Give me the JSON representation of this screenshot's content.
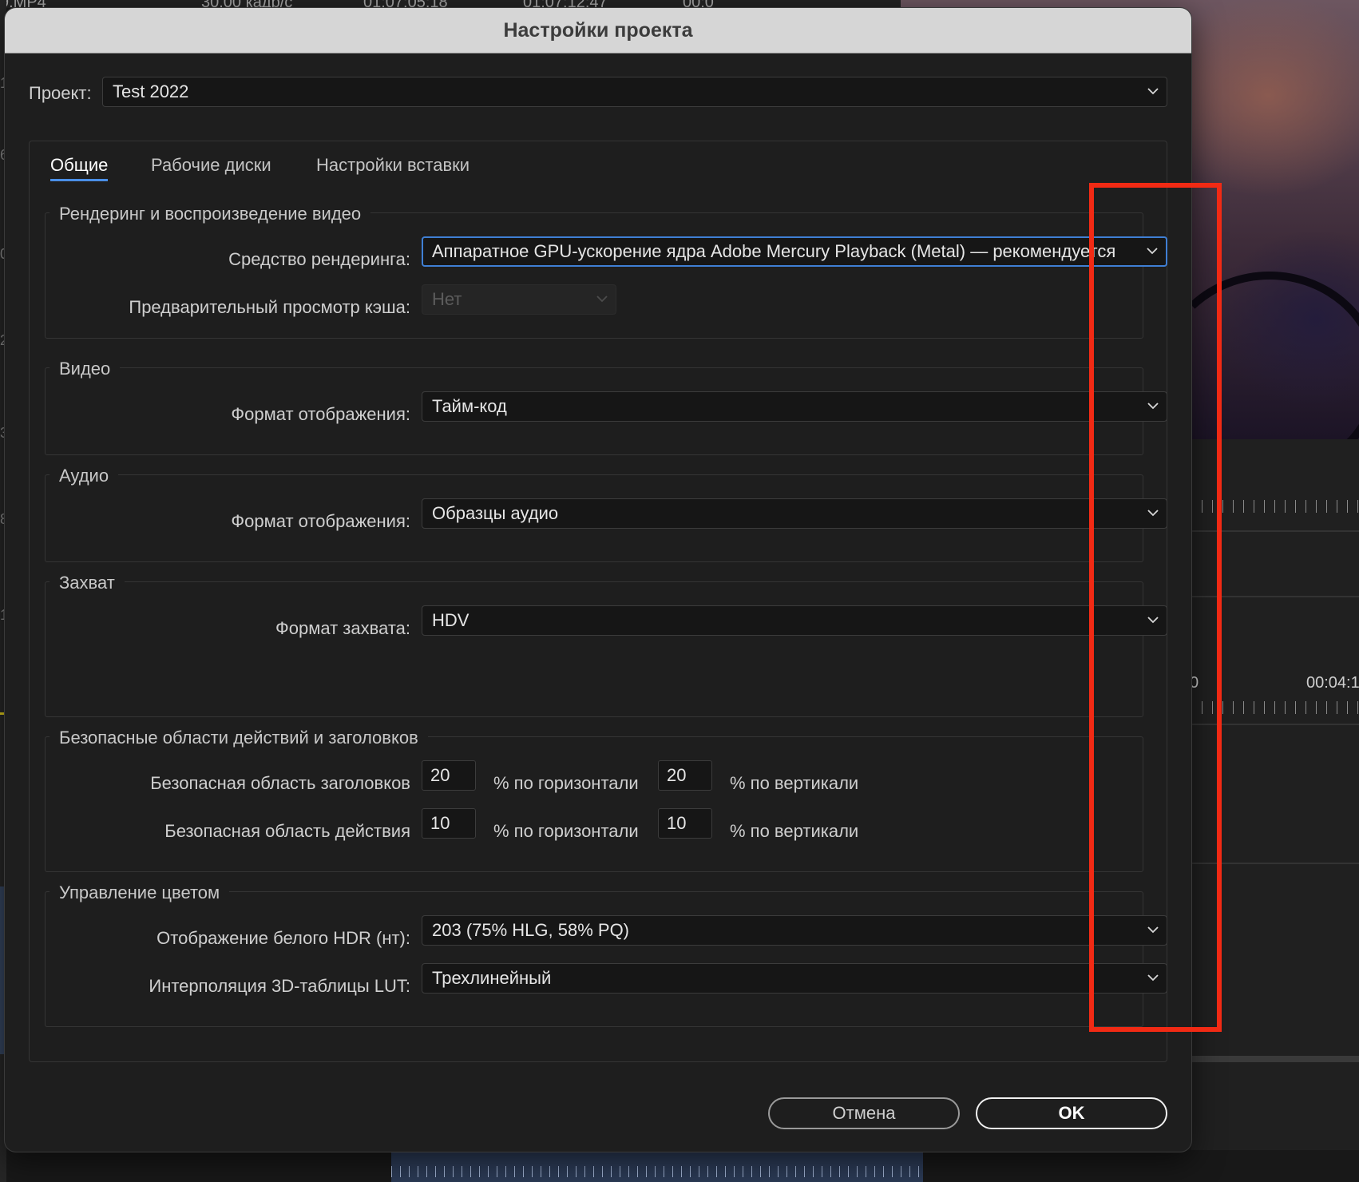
{
  "background": {
    "top_texts": [
      "9.MP4",
      "30,00 кадр/с",
      "01:07:05:18",
      "01:07:12:47",
      "00:0"
    ],
    "left_digits": [
      "1",
      "6",
      "0",
      "2",
      "3",
      "8",
      "1"
    ],
    "timecodes": [
      "0",
      "00:04:1"
    ]
  },
  "dialog": {
    "title": "Настройки проекта",
    "project_label": "Проект:",
    "project_value": "Test 2022",
    "tabs": [
      {
        "label": "Общие",
        "active": true
      },
      {
        "label": "Рабочие диски",
        "active": false
      },
      {
        "label": "Настройки вставки",
        "active": false
      }
    ],
    "render": {
      "title": "Рендеринг и воспроизведение видео",
      "renderer_label": "Средство рендеринга:",
      "renderer_value": "Аппаратное GPU-ускорение ядра Adobe Mercury Playback (Metal)  — рекомендуется",
      "cache_label": "Предварительный просмотр кэша:",
      "cache_value": "Нет"
    },
    "video": {
      "title": "Видео",
      "format_label": "Формат отображения:",
      "format_value": "Тайм-код"
    },
    "audio": {
      "title": "Аудио",
      "format_label": "Формат отображения:",
      "format_value": "Образцы аудио"
    },
    "capture": {
      "title": "Захват",
      "format_label": "Формат захвата:",
      "format_value": "HDV"
    },
    "safe_areas": {
      "title": "Безопасные области действий и заголовков",
      "title_safe_label": "Безопасная область заголовков",
      "title_safe_h": "20",
      "title_safe_v": "20",
      "action_safe_label": "Безопасная область действия",
      "action_safe_h": "10",
      "action_safe_v": "10",
      "h_unit": "% по горизонтали",
      "v_unit": "% по вертикали"
    },
    "color": {
      "title": "Управление цветом",
      "hdr_label": "Отображение белого HDR (нт):",
      "hdr_value": "203 (75% HLG, 58% PQ)",
      "lut_label": "Интерполяция 3D-таблицы LUT:",
      "lut_value": "Трехлинейный"
    },
    "buttons": {
      "cancel": "Отмена",
      "ok": "OK"
    }
  },
  "colors": {
    "accent": "#4a8fe7",
    "annotation": "#f12a14"
  }
}
